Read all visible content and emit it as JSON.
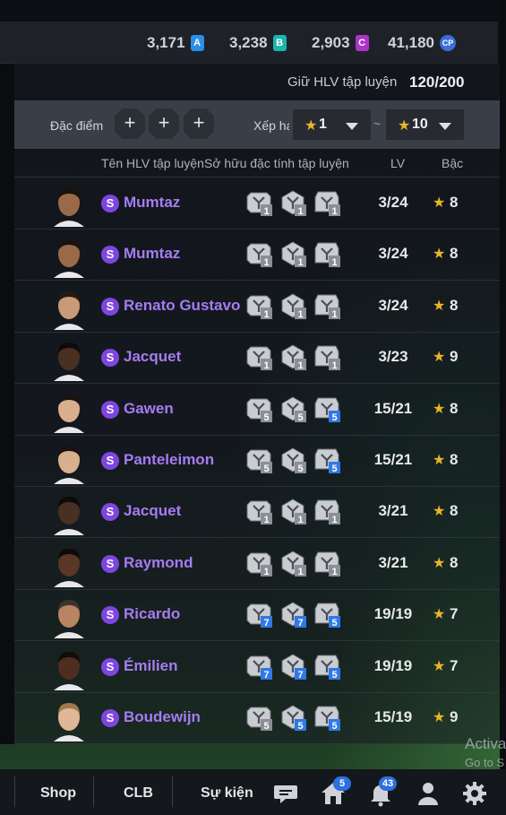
{
  "currency": [
    {
      "value": "3,171",
      "badge": "A",
      "color": "#2a8fe8"
    },
    {
      "value": "3,238",
      "badge": "B",
      "color": "#1bb5b0"
    },
    {
      "value": "2,903",
      "badge": "C",
      "color": "#b033c9"
    },
    {
      "value": "41,180",
      "badge": "CP",
      "color": "#3b6fd8"
    }
  ],
  "keep": {
    "label": "Giữ HLV tập luyện",
    "value": "120/200"
  },
  "filter": {
    "traits_label": "Đặc điểm c",
    "rank_label": "Xếp hạ",
    "rank_from": "1",
    "rank_to": "10",
    "tilde": "~"
  },
  "columns": {
    "name": "Tên HLV tập luyện",
    "traits": "Sở hữu đặc tính tập luyện",
    "lv": "LV",
    "grade": "Bậc"
  },
  "rows": [
    {
      "name": "Mumtaz",
      "lv": "3/24",
      "grade": "8",
      "skin": "#9a6a48",
      "hair": "#1a120c",
      "traits": [
        {
          "level": "1",
          "color": "#8a8f96"
        },
        {
          "level": "1",
          "color": "#8a8f96"
        },
        {
          "level": "1",
          "color": "#8a8f96"
        }
      ]
    },
    {
      "name": "Mumtaz",
      "lv": "3/24",
      "grade": "8",
      "skin": "#9a6a48",
      "hair": "#1a120c",
      "traits": [
        {
          "level": "1",
          "color": "#8a8f96"
        },
        {
          "level": "1",
          "color": "#8a8f96"
        },
        {
          "level": "1",
          "color": "#8a8f96"
        }
      ]
    },
    {
      "name": "Renato Gustavo",
      "lv": "3/24",
      "grade": "8",
      "skin": "#c99a78",
      "hair": "#241a14",
      "traits": [
        {
          "level": "1",
          "color": "#8a8f96"
        },
        {
          "level": "1",
          "color": "#8a8f96"
        },
        {
          "level": "1",
          "color": "#8a8f96"
        }
      ]
    },
    {
      "name": "Jacquet",
      "lv": "3/23",
      "grade": "9",
      "skin": "#4a3022",
      "hair": "#0e0a08",
      "traits": [
        {
          "level": "1",
          "color": "#8a8f96"
        },
        {
          "level": "1",
          "color": "#8a8f96"
        },
        {
          "level": "1",
          "color": "#8a8f96"
        }
      ]
    },
    {
      "name": "Gawen",
      "lv": "15/21",
      "grade": "8",
      "skin": "#d8b08e",
      "hair": "#1a1410",
      "traits": [
        {
          "level": "5",
          "color": "#8a8f96"
        },
        {
          "level": "5",
          "color": "#8a8f96"
        },
        {
          "level": "5",
          "color": "#2f78e6"
        }
      ]
    },
    {
      "name": "Panteleimon",
      "lv": "15/21",
      "grade": "8",
      "skin": "#d8b08e",
      "hair": "#1a1410",
      "traits": [
        {
          "level": "5",
          "color": "#8a8f96"
        },
        {
          "level": "5",
          "color": "#8a8f96"
        },
        {
          "level": "5",
          "color": "#2f78e6"
        }
      ]
    },
    {
      "name": "Jacquet",
      "lv": "3/21",
      "grade": "8",
      "skin": "#4a3022",
      "hair": "#0e0a08",
      "traits": [
        {
          "level": "1",
          "color": "#8a8f96"
        },
        {
          "level": "1",
          "color": "#8a8f96"
        },
        {
          "level": "1",
          "color": "#8a8f96"
        }
      ]
    },
    {
      "name": "Raymond",
      "lv": "3/21",
      "grade": "8",
      "skin": "#5a3626",
      "hair": "#0e0a08",
      "traits": [
        {
          "level": "1",
          "color": "#8a8f96"
        },
        {
          "level": "1",
          "color": "#8a8f96"
        },
        {
          "level": "1",
          "color": "#8a8f96"
        }
      ]
    },
    {
      "name": "Ricardo",
      "lv": "19/19",
      "grade": "7",
      "skin": "#b98462",
      "hair": "#3a3430",
      "traits": [
        {
          "level": "7",
          "color": "#2f78e6"
        },
        {
          "level": "7",
          "color": "#2f78e6"
        },
        {
          "level": "5",
          "color": "#2f78e6"
        }
      ]
    },
    {
      "name": "Émilien",
      "lv": "19/19",
      "grade": "7",
      "skin": "#4e2e20",
      "hair": "#120c08",
      "traits": [
        {
          "level": "7",
          "color": "#2f78e6"
        },
        {
          "level": "7",
          "color": "#2f78e6"
        },
        {
          "level": "5",
          "color": "#2f78e6"
        }
      ]
    },
    {
      "name": "Boudewijn",
      "lv": "15/19",
      "grade": "9",
      "skin": "#e0b898",
      "hair": "#a0784a",
      "traits": [
        {
          "level": "5",
          "color": "#8a8f96"
        },
        {
          "level": "5",
          "color": "#2f78e6"
        },
        {
          "level": "5",
          "color": "#2f78e6"
        }
      ]
    }
  ],
  "nav": {
    "shop": "Shop",
    "club": "CLB",
    "event": "Sự kiện",
    "chat_icon": "chat-bubble-icon",
    "home_icon": "home-icon",
    "home_badge": "5",
    "bell_icon": "bell-icon",
    "bell_badge": "43",
    "profile_icon": "person-icon",
    "settings_icon": "gear-icon"
  },
  "watermark": {
    "line1": "Activa",
    "line2": "Go to S"
  }
}
